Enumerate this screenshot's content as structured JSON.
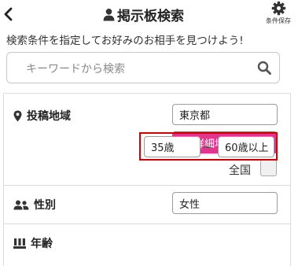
{
  "header": {
    "title": "掲示板検索",
    "back_icon": "chevron-left-icon",
    "title_icon": "user-icon",
    "save_icon": "gear-icon",
    "save_label": "条件保存"
  },
  "intro_text": "検索条件を指定してお好みのお相手を見つけよう!",
  "search": {
    "placeholder": "キーワードから検索",
    "value": "",
    "icon": "search-icon"
  },
  "filters": {
    "region": {
      "icon": "map-marker-icon",
      "label": "投稿地域",
      "value": "東京都",
      "detail_button": "詳細地域設定",
      "nationwide_label": "全国",
      "nationwide_checked": false
    },
    "gender": {
      "icon": "users-icon",
      "label": "性別",
      "value": "女性"
    },
    "age": {
      "icon": "calendar-icon",
      "label": "年齢",
      "min": "35歳",
      "separator": "~",
      "max": "60歳以上"
    }
  },
  "colors": {
    "accent_pink": "#e0368e",
    "highlight_red": "#d40000"
  }
}
